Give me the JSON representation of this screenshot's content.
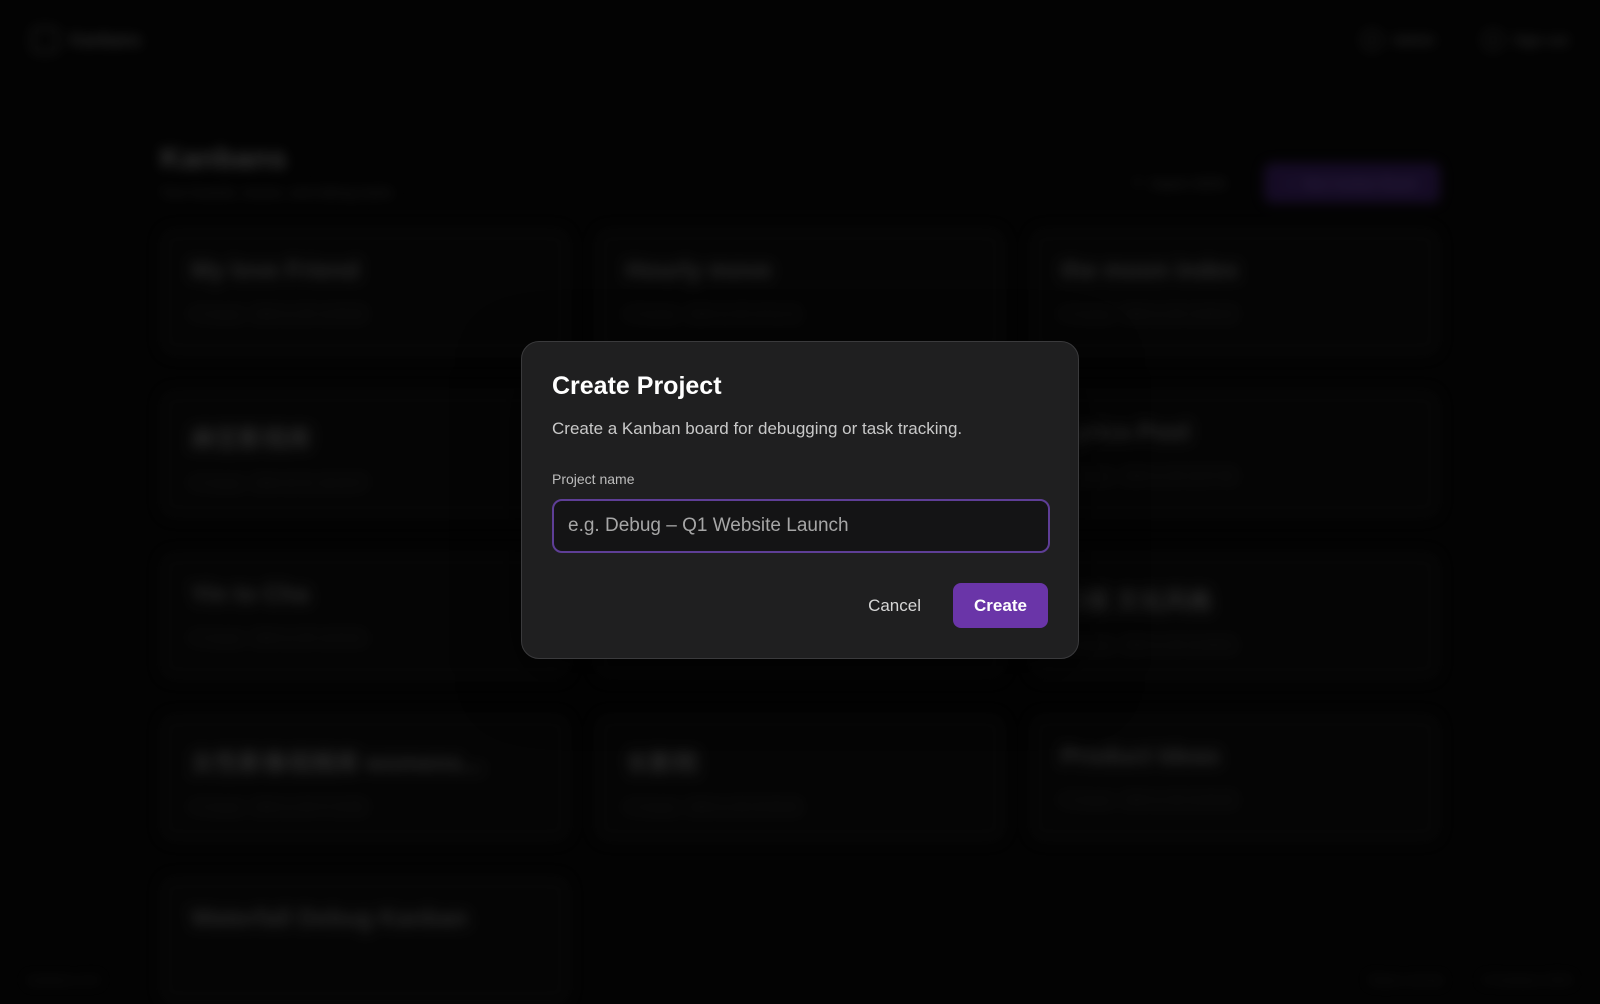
{
  "app": {
    "brand": "Kanbans",
    "top_actions": [
      "Admin",
      "Sign out"
    ]
  },
  "page": {
    "title": "Kanbans",
    "subtitle": "Your boards, issues, and debug tasks",
    "import_label": "Import JSON",
    "new_label": "New Kanban Board"
  },
  "boards": [
    {
      "title": "My love Friend",
      "meta": "• 0 issues · 2024-11-05 14:35:56"
    },
    {
      "title": "Hourly move",
      "meta": "• 0 issues · 2024-11-05 10:31:21"
    },
    {
      "title": "the moon index",
      "meta": "• 0 issues · 2024-11-05 13:09:18"
    },
    {
      "title": "麻豆影视库",
      "meta": "• 0 issues · 2024-10-31 18:23:07"
    },
    {
      "title": "",
      "meta": ""
    },
    {
      "title": "Lyrics Pool",
      "meta": "• 0 issues · 2024-11-05 16:37:48"
    },
    {
      "title": "Yin to Cha",
      "meta": "• 0 issues · 2024-11-05 14:23:41"
    },
    {
      "title": "",
      "meta": ""
    },
    {
      "title": "日报 文化风格",
      "meta": "• 0 issues · 2024-11-05 16:39:55"
    },
    {
      "title": "女性影像视频库 womens...",
      "meta": "• 0 issues · 2024-11-05 07:23:58"
    },
    {
      "title": "长影院",
      "meta": "• 0 issues · 2024-11-05 20:36:35"
    },
    {
      "title": "Product Ideas",
      "meta": "• 0 issues · 2024-11-06 16:36:38"
    },
    {
      "title": "Waterfall Debug Kanban",
      "meta": ""
    }
  ],
  "footer": {
    "left": "kanbans v1.0",
    "right": [
      "Status normal",
      "© Kanbans 2024"
    ]
  },
  "modal": {
    "title": "Create Project",
    "description": "Create a Kanban board for debugging or task tracking.",
    "field_label": "Project name",
    "field_placeholder": "e.g. Debug – Q1 Website Launch",
    "field_value": "",
    "cancel_label": "Cancel",
    "create_label": "Create",
    "accent_color": "#6a35a8"
  }
}
